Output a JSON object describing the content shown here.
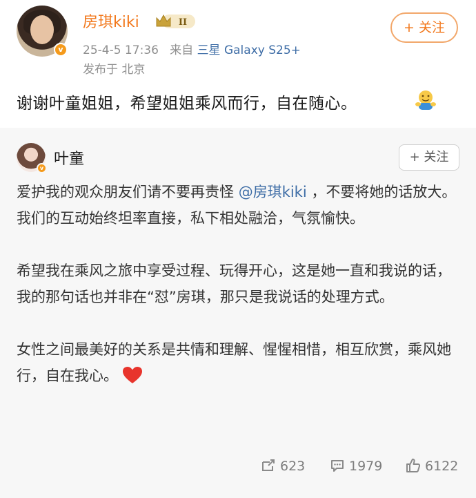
{
  "post": {
    "author": "房琪kiki",
    "level_badge": "II",
    "verified_mark": "v",
    "date": "25-4-5 17:36",
    "source_prefix": "来自",
    "device": "三星 Galaxy S25+",
    "location": "发布于 北京",
    "follow_label": "+ 关注",
    "text": "谢谢叶童姐姐，希望姐姐乘风而行，自在随心。"
  },
  "quoted": {
    "author": "叶童",
    "verified_mark": "v",
    "follow_label": "+ 关注",
    "para1_before": "爱护我的观众朋友们请不要再责怪 ",
    "para1_mention": "@房琪kiki",
    "para1_after": " ，不要将她的话放大。我们的互动始终坦率直接，私下相处融洽，气氛愉快。",
    "para2": "希望我在乘风之旅中享受过程、玩得开心，这是她一直和我说的话，我的那句话也并非在“怼”房琪，那只是我说话的处理方式。",
    "para3": "女性之间最美好的关系是共情和理解、惺惺相惜，相互欣赏，乘风她行，自在我心。",
    "stats": {
      "reposts": "623",
      "comments": "1979",
      "likes": "6122"
    }
  },
  "icons": [
    "verified-badge-icon",
    "level-crown-icon",
    "hug-emoji-icon",
    "heart-emoji-icon",
    "repost-icon",
    "comment-icon",
    "like-icon"
  ],
  "colors": {
    "username": "#f2781c",
    "link": "#3e6da6",
    "heart": "#e8342c"
  }
}
